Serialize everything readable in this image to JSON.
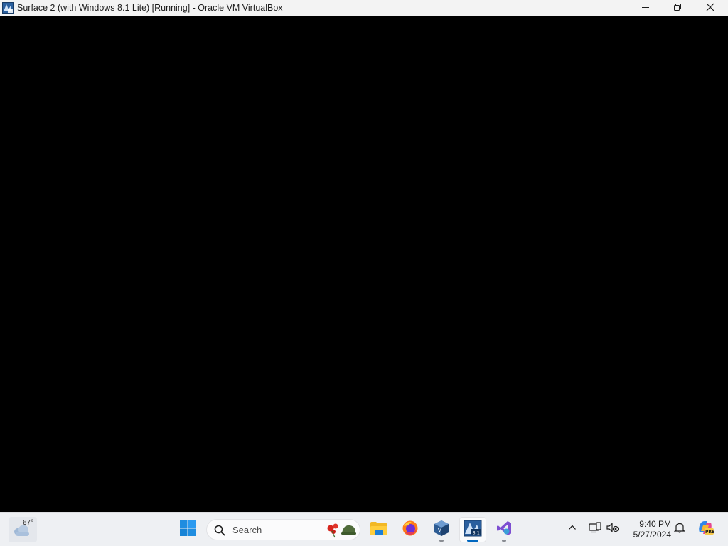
{
  "window": {
    "title": "Surface 2 (with Windows 8.1 Lite) [Running] - Oracle VM VirtualBox",
    "app_icon": "virtualbox-vm-icon",
    "controls": [
      "minimize-icon",
      "restore-icon",
      "close-icon"
    ]
  },
  "taskbar": {
    "weather": {
      "temperature": "67°",
      "icon": "cloud-icon"
    },
    "start_icon": "windows-logo-icon",
    "search": {
      "placeholder": "Search",
      "icon": "search-icon",
      "decoration": "poppies-helmet-icon"
    },
    "apps": [
      {
        "name": "file-explorer",
        "icon": "folder-icon"
      },
      {
        "name": "firefox",
        "icon": "firefox-icon"
      },
      {
        "name": "virtualbox-manager",
        "icon": "virtualbox-icon"
      },
      {
        "name": "virtualbox-vm-window",
        "icon": "vm-81-icon"
      },
      {
        "name": "visual-studio",
        "icon": "visual-studio-icon"
      }
    ],
    "tray": {
      "chevron_icon": "chevron-up-icon",
      "network_icon": "network-icon",
      "volume_icon": "speaker-muted-icon",
      "time": "9:40 PM",
      "date": "5/27/2024",
      "notification_icon": "bell-icon",
      "copilot_icon": "copilot-icon"
    },
    "colors": {
      "accent": "#0067c0",
      "taskbar_bg": "#eef0f3"
    }
  }
}
